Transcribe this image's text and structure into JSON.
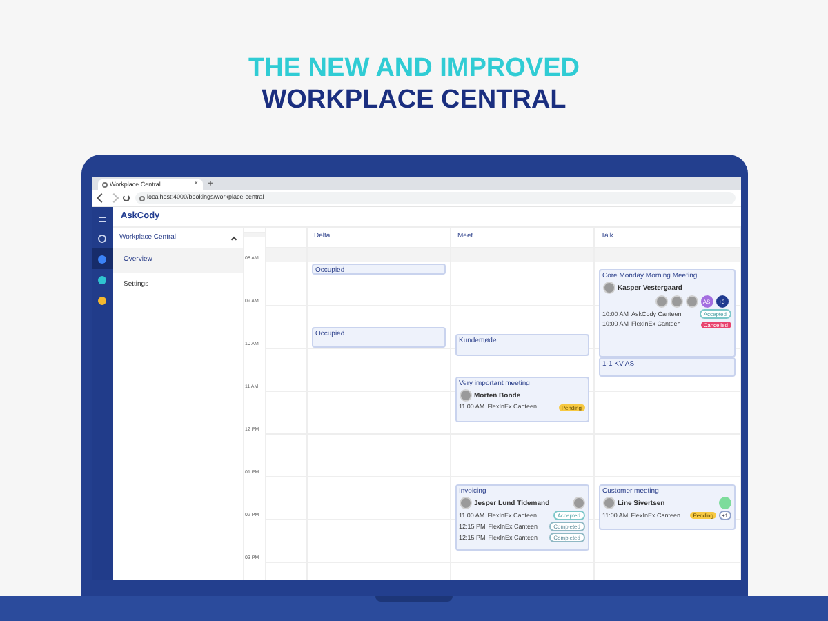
{
  "headline": {
    "line_1": "THE NEW AND IMPROVED",
    "line_2": "WORKPLACE CENTRAL"
  },
  "browser": {
    "tab_title": "Workplace Central",
    "tab_close": "×",
    "new_tab": "+",
    "url": "localhost:4000/bookings/workplace-central"
  },
  "app": {
    "brand": "AskCody"
  },
  "rail": [
    {
      "kind": "outline",
      "selected": false
    },
    {
      "kind": "dot",
      "color": "#3b82f6",
      "selected": true
    },
    {
      "kind": "dot",
      "color": "#2fc4d0",
      "selected": false
    },
    {
      "kind": "dot",
      "color": "#f5b82e",
      "selected": false
    }
  ],
  "sidebar": {
    "section": "Workplace Central",
    "expanded": true,
    "items": [
      {
        "label": "Overview",
        "selected": true
      },
      {
        "label": "Settings",
        "selected": false
      }
    ]
  },
  "calendar": {
    "times": [
      "08 AM",
      "09 AM",
      "10 AM",
      "11 AM",
      "12 PM",
      "01 PM",
      "02 PM",
      "03 PM"
    ],
    "columns": [
      {
        "name": "Delta",
        "events": [
          {
            "title": "Occupied"
          },
          {
            "title": "Occupied"
          }
        ]
      },
      {
        "name": "Meet",
        "events": [
          {
            "title": "Kundemøde"
          },
          {
            "title": "Very important meeting",
            "host": "Morten Bonde",
            "bookings": [
              {
                "time": "11:00 AM",
                "place": "FlexInEx Canteen",
                "status": "Pending",
                "kind": "pending"
              }
            ]
          },
          {
            "title": "Invoicing",
            "host": "Jesper Lund Tidemand",
            "guest_avatar": {
              "kind": "photo"
            },
            "bookings": [
              {
                "time": "11:00 AM",
                "place": "FlexInEx Canteen",
                "status": "Accepted",
                "kind": "accepted"
              },
              {
                "time": "12:15 PM",
                "place": "FlexInEx Canteen",
                "status": "Completed",
                "kind": "completed"
              },
              {
                "time": "12:15 PM",
                "place": "FlexInEx Canteen",
                "status": "Completed",
                "kind": "completed"
              }
            ]
          }
        ]
      },
      {
        "name": "Talk",
        "events": [
          {
            "title": "Core Monday Morning Meeting",
            "host": "Kasper Vestergaard",
            "attendees": [
              {
                "kind": "photo"
              },
              {
                "kind": "photo"
              },
              {
                "kind": "photo"
              },
              {
                "kind": "initials",
                "text": "AS",
                "color": "#a46fe0"
              },
              {
                "kind": "initials",
                "text": "+3",
                "color": "#1f3a8f"
              }
            ],
            "bookings": [
              {
                "time": "10:00 AM",
                "place": "AskCody Canteen",
                "status": "Accepted",
                "kind": "accepted"
              },
              {
                "time": "10:00 AM",
                "place": "FlexInEx Canteen",
                "status": "Cancelled",
                "kind": "cancelled"
              }
            ]
          },
          {
            "title": "1-1 KV AS"
          },
          {
            "title": "Customer meeting",
            "host": "Line Sivertsen",
            "guest_avatar": {
              "kind": "color",
              "color": "#7ddc9c"
            },
            "bookings": [
              {
                "time": "11:00 AM",
                "place": "FlexInEx Canteen",
                "status": "Pending",
                "kind": "pending",
                "extra": "+1"
              }
            ]
          }
        ]
      }
    ]
  }
}
